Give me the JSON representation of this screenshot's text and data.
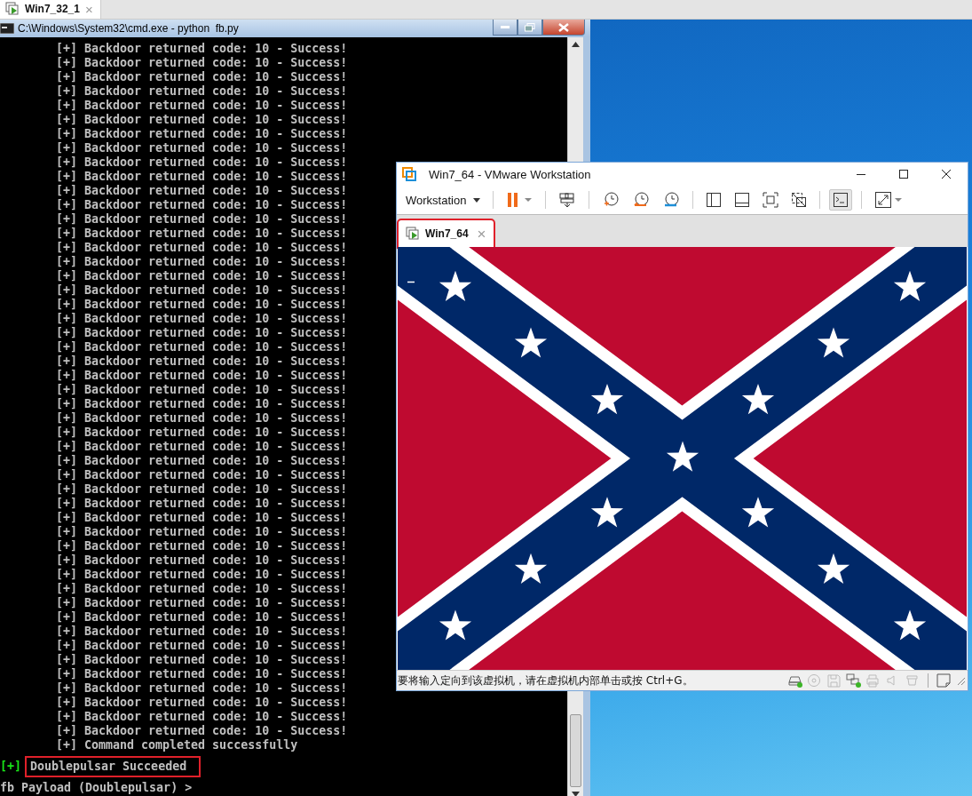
{
  "host_tabs": [
    {
      "label": "Win7_32_1",
      "close": "×",
      "selected": true
    }
  ],
  "console_window": {
    "title": "C:\\Windows\\System32\\cmd.exe - python  fb.py",
    "lines": [
      {
        "kind": "detail",
        "text": "[+] Backdoor returned code: 10 - Success!"
      },
      {
        "kind": "detail",
        "text": "[+] Backdoor returned code: 10 - Success!"
      },
      {
        "kind": "detail",
        "text": "[+] Backdoor returned code: 10 - Success!"
      },
      {
        "kind": "detail",
        "text": "[+] Backdoor returned code: 10 - Success!"
      },
      {
        "kind": "detail",
        "text": "[+] Backdoor returned code: 10 - Success!"
      },
      {
        "kind": "detail",
        "text": "[+] Backdoor returned code: 10 - Success!"
      },
      {
        "kind": "detail",
        "text": "[+] Backdoor returned code: 10 - Success!"
      },
      {
        "kind": "detail",
        "text": "[+] Backdoor returned code: 10 - Success!"
      },
      {
        "kind": "detail",
        "text": "[+] Backdoor returned code: 10 - Success!"
      },
      {
        "kind": "detail",
        "text": "[+] Backdoor returned code: 10 - Success!"
      },
      {
        "kind": "detail",
        "text": "[+] Backdoor returned code: 10 - Success!"
      },
      {
        "kind": "detail",
        "text": "[+] Backdoor returned code: 10 - Success!"
      },
      {
        "kind": "detail",
        "text": "[+] Backdoor returned code: 10 - Success!"
      },
      {
        "kind": "detail",
        "text": "[+] Backdoor returned code: 10 - Success!"
      },
      {
        "kind": "detail",
        "text": "[+] Backdoor returned code: 10 - Success!"
      },
      {
        "kind": "detail",
        "text": "[+] Backdoor returned code: 10 - Success!"
      },
      {
        "kind": "detail",
        "text": "[+] Backdoor returned code: 10 - Success!"
      },
      {
        "kind": "detail",
        "text": "[+] Backdoor returned code: 10 - Success!"
      },
      {
        "kind": "detail",
        "text": "[+] Backdoor returned code: 10 - Success!"
      },
      {
        "kind": "detail",
        "text": "[+] Backdoor returned code: 10 - Success!"
      },
      {
        "kind": "detail",
        "text": "[+] Backdoor returned code: 10 - Success!"
      },
      {
        "kind": "detail",
        "text": "[+] Backdoor returned code: 10 - Success!"
      },
      {
        "kind": "detail",
        "text": "[+] Backdoor returned code: 10 - Success!"
      },
      {
        "kind": "detail",
        "text": "[+] Backdoor returned code: 10 - Success!"
      },
      {
        "kind": "detail",
        "text": "[+] Backdoor returned code: 10 - Success!"
      },
      {
        "kind": "detail",
        "text": "[+] Backdoor returned code: 10 - Success!"
      },
      {
        "kind": "detail",
        "text": "[+] Backdoor returned code: 10 - Success!"
      },
      {
        "kind": "detail",
        "text": "[+] Backdoor returned code: 10 - Success!"
      },
      {
        "kind": "detail",
        "text": "[+] Backdoor returned code: 10 - Success!"
      },
      {
        "kind": "detail",
        "text": "[+] Backdoor returned code: 10 - Success!"
      },
      {
        "kind": "detail",
        "text": "[+] Backdoor returned code: 10 - Success!"
      },
      {
        "kind": "detail",
        "text": "[+] Backdoor returned code: 10 - Success!"
      },
      {
        "kind": "detail",
        "text": "[+] Backdoor returned code: 10 - Success!"
      },
      {
        "kind": "detail",
        "text": "[+] Backdoor returned code: 10 - Success!"
      },
      {
        "kind": "detail",
        "text": "[+] Backdoor returned code: 10 - Success!"
      },
      {
        "kind": "detail",
        "text": "[+] Backdoor returned code: 10 - Success!"
      },
      {
        "kind": "detail",
        "text": "[+] Backdoor returned code: 10 - Success!"
      },
      {
        "kind": "detail",
        "text": "[+] Backdoor returned code: 10 - Success!"
      },
      {
        "kind": "detail",
        "text": "[+] Backdoor returned code: 10 - Success!"
      },
      {
        "kind": "detail",
        "text": "[+] Backdoor returned code: 10 - Success!"
      },
      {
        "kind": "detail",
        "text": "[+] Backdoor returned code: 10 - Success!"
      },
      {
        "kind": "detail",
        "text": "[+] Backdoor returned code: 10 - Success!"
      },
      {
        "kind": "detail",
        "text": "[+] Backdoor returned code: 10 - Success!"
      },
      {
        "kind": "detail",
        "text": "[+] Backdoor returned code: 10 - Success!"
      },
      {
        "kind": "detail",
        "text": "[+] Backdoor returned code: 10 - Success!"
      },
      {
        "kind": "detail",
        "text": "[+] Backdoor returned code: 10 - Success!"
      },
      {
        "kind": "detail",
        "text": "[+] Backdoor returned code: 10 - Success!"
      },
      {
        "kind": "detail",
        "text": "[+] Backdoor returned code: 10 - Success!"
      },
      {
        "kind": "detail",
        "text": "[+] Backdoor returned code: 10 - Success!"
      },
      {
        "kind": "detail",
        "text": "[+] Command completed successfully"
      },
      {
        "kind": "result",
        "prefix": "[+]",
        "text": "Doublepulsar Succeeded",
        "highlighted": true
      },
      {
        "kind": "prompt",
        "text": "fb Payload (Doublepulsar) >"
      }
    ]
  },
  "vm_window": {
    "title": "Win7_64 - VMware Workstation",
    "menu": "Workstation",
    "toolbar": [
      {
        "kind": "pause",
        "selected": false
      },
      {
        "kind": "send-keys",
        "selected": false
      },
      {
        "kind": "snapshot-take",
        "selected": false
      },
      {
        "kind": "snapshot-revert",
        "selected": false
      },
      {
        "kind": "snapshot-manager",
        "selected": false
      },
      {
        "kind": "library",
        "selected": false
      },
      {
        "kind": "thumbnails",
        "selected": false
      },
      {
        "kind": "full-screen",
        "selected": false
      },
      {
        "kind": "unity",
        "selected": false
      },
      {
        "kind": "console-view",
        "selected": true
      },
      {
        "kind": "stretch",
        "selected": false
      }
    ],
    "tabs": [
      {
        "label": "Win7_64",
        "close": "×",
        "selected": true,
        "highlighted": true
      }
    ],
    "status_bar": {
      "message": "要将输入定向到该虚拟机，请在虚拟机内部单击或按 Ctrl+G。",
      "devices": [
        {
          "kind": "disk",
          "connected": true
        },
        {
          "kind": "cd",
          "connected": false
        },
        {
          "kind": "floppy",
          "connected": false
        },
        {
          "kind": "network",
          "connected": true
        },
        {
          "kind": "printer",
          "connected": false
        },
        {
          "kind": "sound",
          "connected": false
        },
        {
          "kind": "usb",
          "connected": false
        }
      ]
    }
  }
}
